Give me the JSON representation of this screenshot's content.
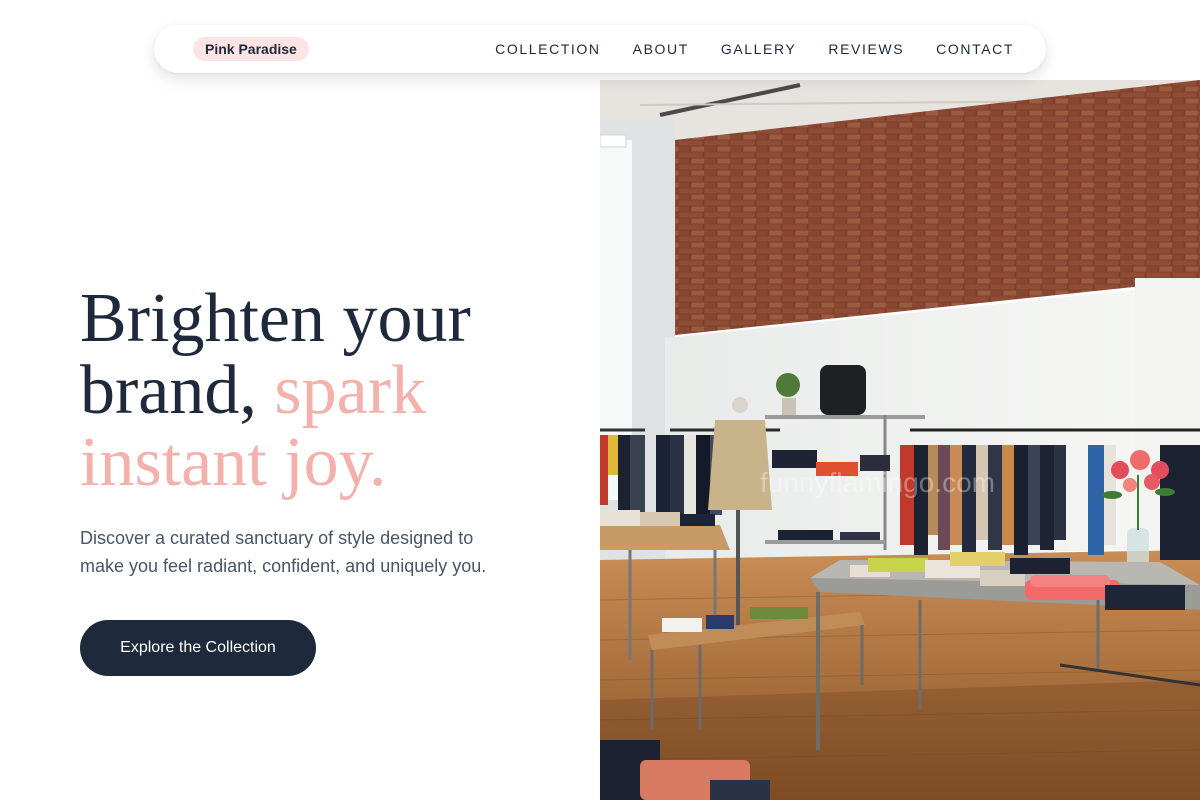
{
  "brand": {
    "name": "Pink Paradise"
  },
  "nav": {
    "links": [
      "COLLECTION",
      "ABOUT",
      "GALLERY",
      "REVIEWS",
      "CONTACT"
    ]
  },
  "hero": {
    "headline_part1": "Brighten your brand, ",
    "headline_accent": "spark instant joy.",
    "subtext": "Discover a curated sanctuary of style designed to make you feel radiant, confident, and uniquely you.",
    "cta_label": "Explore the Collection",
    "image_watermark": "funnyflamingo.com"
  },
  "colors": {
    "accent_pink": "#f4b1ab",
    "brand_badge_bg": "#fde4e4",
    "navy": "#1e293b",
    "body_text": "#475569"
  }
}
